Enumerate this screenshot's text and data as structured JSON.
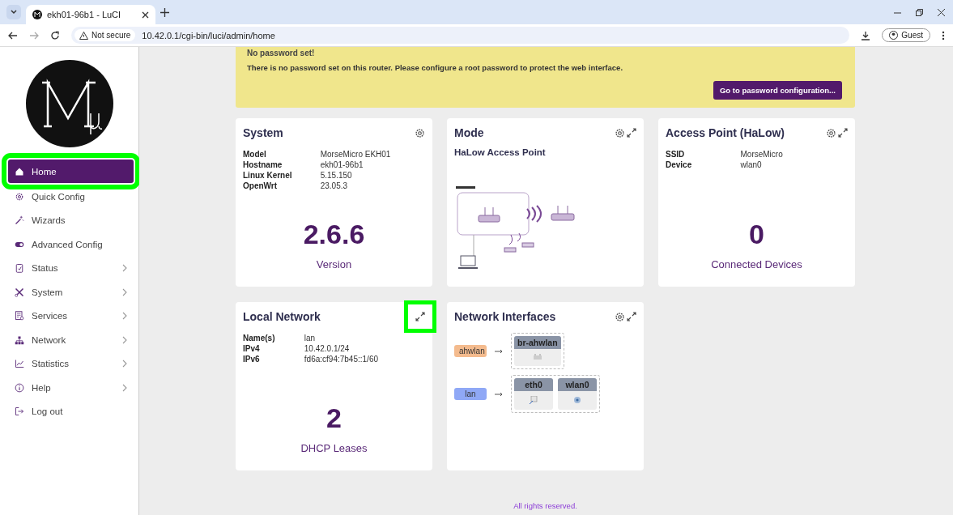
{
  "browser": {
    "tab_title": "ekh01-96b1 - LuCI",
    "security": "Not secure",
    "url": "10.42.0.1/cgi-bin/luci/admin/home",
    "profile": "Guest"
  },
  "sidebar": {
    "items": [
      {
        "label": "Home",
        "selected": true,
        "submenu": false,
        "highlighted": true
      },
      {
        "label": "Quick Config",
        "selected": false,
        "submenu": false,
        "highlighted": false
      },
      {
        "label": "Wizards",
        "selected": false,
        "submenu": false,
        "highlighted": false
      },
      {
        "label": "Advanced Config",
        "selected": false,
        "submenu": false,
        "highlighted": false
      },
      {
        "label": "Status",
        "selected": false,
        "submenu": true,
        "highlighted": false
      },
      {
        "label": "System",
        "selected": false,
        "submenu": true,
        "highlighted": false
      },
      {
        "label": "Services",
        "selected": false,
        "submenu": true,
        "highlighted": false
      },
      {
        "label": "Network",
        "selected": false,
        "submenu": true,
        "highlighted": false
      },
      {
        "label": "Statistics",
        "selected": false,
        "submenu": true,
        "highlighted": false
      },
      {
        "label": "Help",
        "selected": false,
        "submenu": true,
        "highlighted": false
      },
      {
        "label": "Log out",
        "selected": false,
        "submenu": false,
        "highlighted": false
      }
    ]
  },
  "banner": {
    "title": "No password set!",
    "message": "There is no password set on this router. Please configure a root password to protect the web interface.",
    "button": "Go to password configuration..."
  },
  "cards": [
    {
      "kind": "stat",
      "title": "System",
      "settings": true,
      "expand": false,
      "fields": [
        {
          "label": "Model",
          "value": "MorseMicro EKH01"
        },
        {
          "label": "Hostname",
          "value": "ekh01-96b1"
        },
        {
          "label": "Linux Kernel",
          "value": "5.15.150"
        },
        {
          "label": "OpenWrt",
          "value": "23.05.3"
        }
      ],
      "big": "2.6.6",
      "caption": "Version"
    },
    {
      "kind": "diagram",
      "title": "Mode",
      "settings": true,
      "expand": true,
      "expand_highlighted": false,
      "subtitle": "HaLow Access Point"
    },
    {
      "kind": "stat",
      "title": "Access Point (HaLow)",
      "settings": true,
      "expand": true,
      "expand_highlighted": false,
      "fields": [
        {
          "label": "SSID",
          "value": "MorseMicro"
        },
        {
          "label": "Device",
          "value": "wlan0"
        }
      ],
      "big": "0",
      "caption": "Connected Devices"
    },
    {
      "kind": "stat",
      "title": "Local Network",
      "settings": false,
      "expand": true,
      "expand_highlighted": true,
      "fields": [
        {
          "label": "Name(s)",
          "value": "lan"
        },
        {
          "label": "IPv4",
          "value": "10.42.0.1/24"
        },
        {
          "label": "IPv6",
          "value": "fd6a:cf94:7b45::1/60"
        }
      ],
      "big": "2",
      "caption": "DHCP Leases"
    },
    {
      "kind": "interfaces",
      "title": "Network Interfaces",
      "settings": true,
      "expand": true,
      "expand_highlighted": false,
      "networks": [
        {
          "name": "ahwlan",
          "color": "#f4bb8e",
          "devices": [
            {
              "name": "br-ahwlan"
            }
          ]
        },
        {
          "name": "lan",
          "color": "#8fa8f6",
          "devices": [
            {
              "name": "eth0"
            },
            {
              "name": "wlan0"
            }
          ]
        }
      ]
    }
  ],
  "footer": "All rights reserved."
}
